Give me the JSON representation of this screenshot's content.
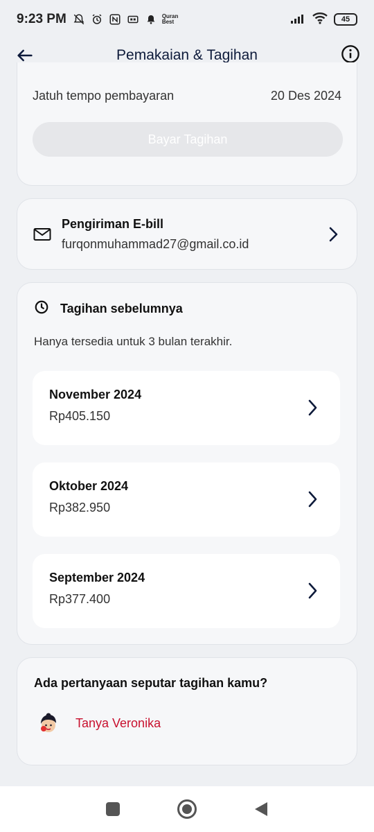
{
  "status_bar": {
    "time": "9:23 PM",
    "quran_badge_line1": "Quran",
    "quran_badge_line2": "Best",
    "battery": "45"
  },
  "header": {
    "title": "Pemakaian & Tagihan"
  },
  "due": {
    "label": "Jatuh tempo pembayaran",
    "date": "20 Des 2024",
    "pay_button": "Bayar Tagihan"
  },
  "ebill": {
    "title": "Pengiriman E-bill",
    "email": "furqonmuhammad27@gmail.co.id"
  },
  "history": {
    "title": "Tagihan sebelumnya",
    "note": "Hanya tersedia untuk 3 bulan terakhir.",
    "items": [
      {
        "month": "November 2024",
        "amount": "Rp405.150"
      },
      {
        "month": "Oktober 2024",
        "amount": "Rp382.950"
      },
      {
        "month": "September 2024",
        "amount": "Rp377.400"
      }
    ]
  },
  "faq": {
    "question": "Ada pertanyaan seputar tagihan kamu?",
    "link": "Tanya Veronika"
  },
  "colors": {
    "accent_navy": "#0d1a3a",
    "link_red": "#c8102e"
  }
}
